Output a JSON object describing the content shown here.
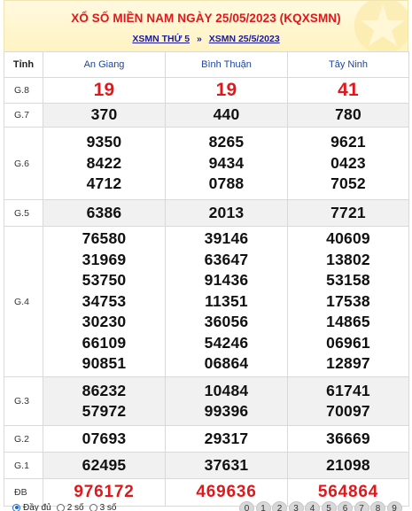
{
  "header": {
    "title": "XỔ SỐ MIỀN NAM NGÀY 25/05/2023 (KQXSMN)",
    "link_weekday": "XSMN THỨ 5",
    "separator": "»",
    "link_date": "XSMN 25/5/2023"
  },
  "table": {
    "prize_header": "Tỉnh",
    "provinces": [
      "An Giang",
      "Bình Thuận",
      "Tây Ninh"
    ],
    "rows": [
      {
        "prize": "G.8",
        "values": [
          [
            "19"
          ],
          [
            "19"
          ],
          [
            "41"
          ]
        ]
      },
      {
        "prize": "G.7",
        "values": [
          [
            "370"
          ],
          [
            "440"
          ],
          [
            "780"
          ]
        ]
      },
      {
        "prize": "G.6",
        "values": [
          [
            "9350",
            "8422",
            "4712"
          ],
          [
            "8265",
            "9434",
            "0788"
          ],
          [
            "9621",
            "0423",
            "7052"
          ]
        ]
      },
      {
        "prize": "G.5",
        "values": [
          [
            "6386"
          ],
          [
            "2013"
          ],
          [
            "7721"
          ]
        ]
      },
      {
        "prize": "G.4",
        "values": [
          [
            "76580",
            "31969",
            "53750",
            "34753",
            "30230",
            "66109",
            "90851"
          ],
          [
            "39146",
            "63647",
            "91436",
            "11351",
            "36056",
            "54246",
            "06864"
          ],
          [
            "40609",
            "13802",
            "53158",
            "17538",
            "14865",
            "06961",
            "12897"
          ]
        ]
      },
      {
        "prize": "G.3",
        "values": [
          [
            "86232",
            "57972"
          ],
          [
            "10484",
            "99396"
          ],
          [
            "61741",
            "70097"
          ]
        ]
      },
      {
        "prize": "G.2",
        "values": [
          [
            "07693"
          ],
          [
            "29317"
          ],
          [
            "36669"
          ]
        ]
      },
      {
        "prize": "G.1",
        "values": [
          [
            "62495"
          ],
          [
            "37631"
          ],
          [
            "21098"
          ]
        ]
      },
      {
        "prize": "ĐB",
        "values": [
          [
            "976172"
          ],
          [
            "469636"
          ],
          [
            "564864"
          ]
        ]
      }
    ]
  },
  "footer": {
    "options": [
      "Đầy đủ",
      "2 số",
      "3 số"
    ],
    "selected_option": "Đầy đủ",
    "digits": [
      "0",
      "1",
      "2",
      "3",
      "4",
      "5",
      "6",
      "7",
      "8",
      "9"
    ]
  },
  "colors": {
    "accent_red": "#e0181b",
    "link_blue": "#1a1a9c",
    "header_bg": "#fff3c2",
    "row_alt_bg": "#f1f1f1"
  }
}
